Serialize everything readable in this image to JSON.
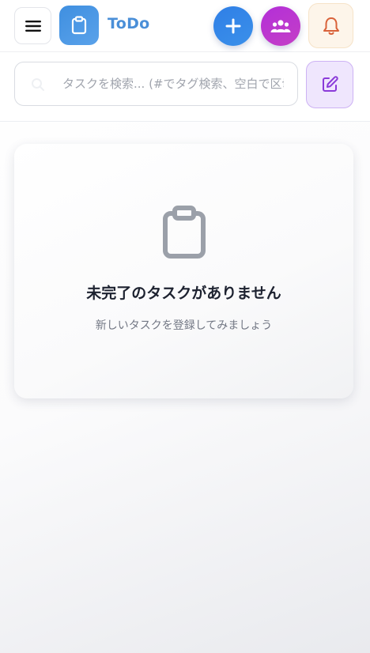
{
  "header": {
    "title": "ToDo",
    "icons": {
      "menu": "hamburger-menu-icon",
      "logo": "clipboard-icon",
      "add": "plus-icon",
      "team": "users-group-icon",
      "notifications": "bell-icon"
    }
  },
  "search": {
    "placeholder": "タスクを検索... (#でタグ検索、空白で区切って複数検索)",
    "value": "",
    "icons": {
      "search": "search-icon",
      "edit": "edit-pencil-icon"
    }
  },
  "empty_state": {
    "icon": "clipboard-icon",
    "title": "未完了のタスクがありません",
    "subtitle": "新しいタスクを登録してみましょう"
  },
  "colors": {
    "accent_blue": "#3b8ae6",
    "accent_purple": "#b935d3",
    "bell_orange": "#d9623a",
    "edit_purple": "#8a3ad9",
    "title_blue": "#4a8fd8"
  }
}
